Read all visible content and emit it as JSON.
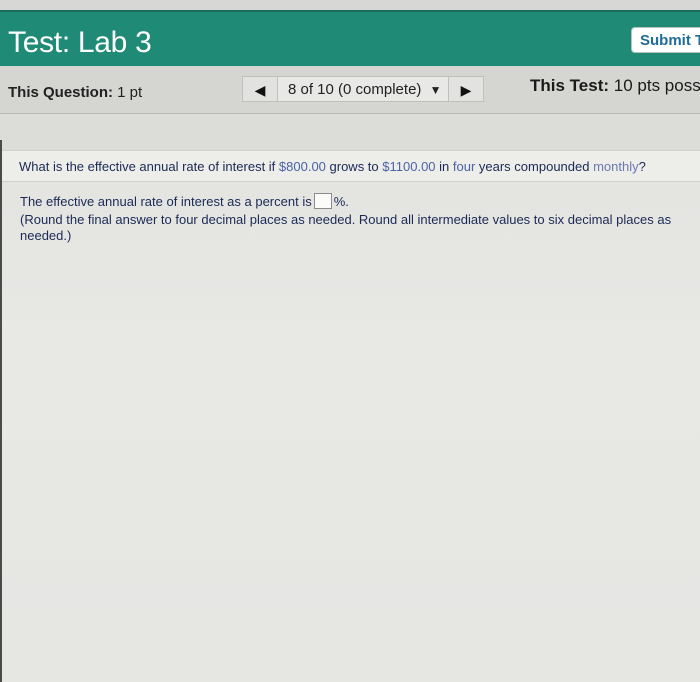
{
  "header": {
    "title": "Test: Lab 3",
    "submit_label": "Submit T"
  },
  "infobar": {
    "question_label": "This Question:",
    "question_points": "1 pt",
    "progress": "8 of 10 (0 complete)",
    "test_label": "This Test:",
    "test_points": "10 pts poss"
  },
  "question": {
    "prefix": "What is the effective annual rate of interest if ",
    "principal": "$800.00",
    "mid1": " grows to ",
    "future_value": "$1100.00",
    "mid2": " in ",
    "period": "four",
    "mid3": " years compounded ",
    "compounding": "monthly",
    "suffix": "?"
  },
  "answer": {
    "prefix": "The effective annual rate of interest as a percent is",
    "suffix": "%."
  },
  "instructions": "(Round the final answer to four decimal places as needed. Round all intermediate values to six decimal places as needed.)",
  "icons": {
    "prev": "◀",
    "next": "▶",
    "dropdown": "▼"
  },
  "colors": {
    "header_bg": "#1f8a75",
    "submit_text": "#1f6c98"
  }
}
